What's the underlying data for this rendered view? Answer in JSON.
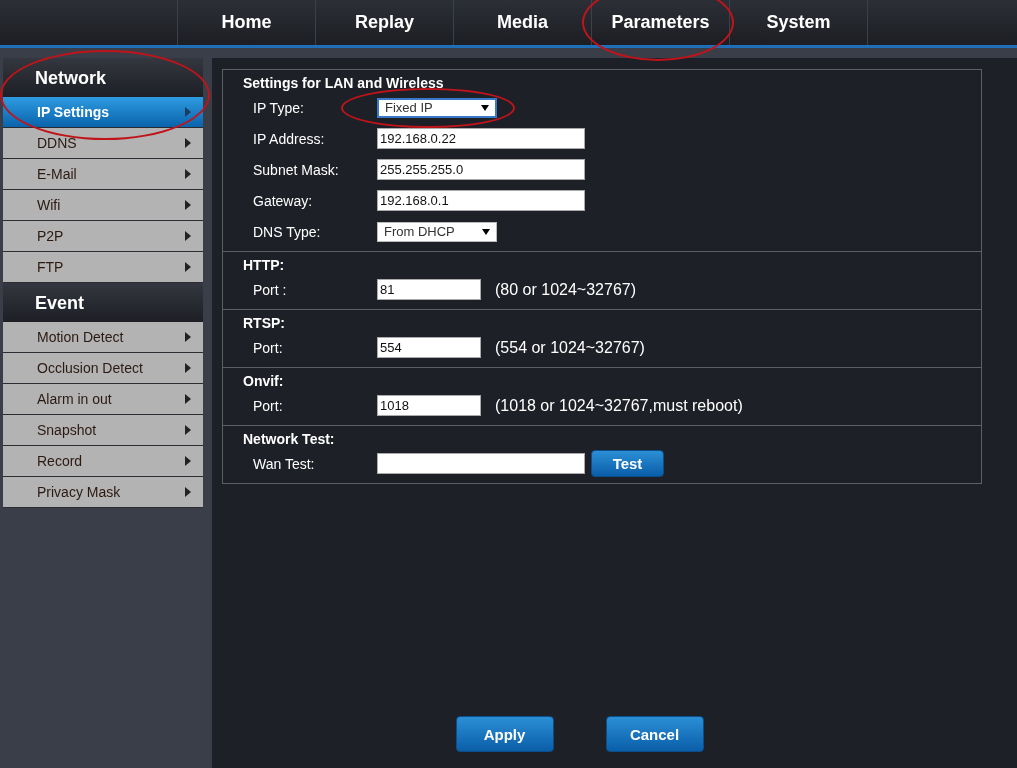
{
  "nav_tabs": [
    {
      "label": "Home",
      "highlighted": false
    },
    {
      "label": "Replay",
      "highlighted": false
    },
    {
      "label": "Media",
      "highlighted": false
    },
    {
      "label": "Parameters",
      "highlighted": true
    },
    {
      "label": "System",
      "highlighted": false
    }
  ],
  "sidebar": {
    "sections": [
      {
        "title": "Network",
        "highlighted": true,
        "items": [
          {
            "label": "IP Settings",
            "selected": true
          },
          {
            "label": "DDNS",
            "selected": false
          },
          {
            "label": "E-Mail",
            "selected": false
          },
          {
            "label": "Wifi",
            "selected": false
          },
          {
            "label": "P2P",
            "selected": false
          },
          {
            "label": "FTP",
            "selected": false
          }
        ]
      },
      {
        "title": "Event",
        "highlighted": false,
        "items": [
          {
            "label": "Motion Detect",
            "selected": false
          },
          {
            "label": "Occlusion Detect",
            "selected": false
          },
          {
            "label": "Alarm in out",
            "selected": false
          },
          {
            "label": "Snapshot",
            "selected": false
          },
          {
            "label": "Record",
            "selected": false
          },
          {
            "label": "Privacy Mask",
            "selected": false
          }
        ]
      }
    ]
  },
  "form_groups": [
    {
      "title": "Settings for LAN and Wireless",
      "rows": [
        {
          "label": "IP Type:",
          "kind": "select",
          "value": "Fixed IP",
          "highlighted": true
        },
        {
          "label": "IP Address:",
          "kind": "text",
          "value": "192.168.0.22"
        },
        {
          "label": "Subnet Mask:",
          "kind": "text",
          "value": "255.255.255.0"
        },
        {
          "label": "Gateway:",
          "kind": "text",
          "value": "192.168.0.1"
        },
        {
          "label": "DNS Type:",
          "kind": "select",
          "value": "From DHCP",
          "highlighted": false
        }
      ]
    },
    {
      "title": "HTTP:",
      "rows": [
        {
          "label": "Port :",
          "kind": "port",
          "value": "81",
          "hint": "(80 or 1024~32767)"
        }
      ]
    },
    {
      "title": "RTSP:",
      "rows": [
        {
          "label": "Port:",
          "kind": "port",
          "value": "554",
          "hint": "(554 or 1024~32767)"
        }
      ]
    },
    {
      "title": "Onvif:",
      "rows": [
        {
          "label": "Port:",
          "kind": "port",
          "value": "1018",
          "hint": "(1018 or 1024~32767,must reboot)"
        }
      ]
    },
    {
      "title": "Network Test:",
      "rows": [
        {
          "label": "Wan Test:",
          "kind": "test",
          "value": "",
          "button": "Test"
        }
      ]
    }
  ],
  "buttons": [
    "Apply",
    "Cancel"
  ]
}
